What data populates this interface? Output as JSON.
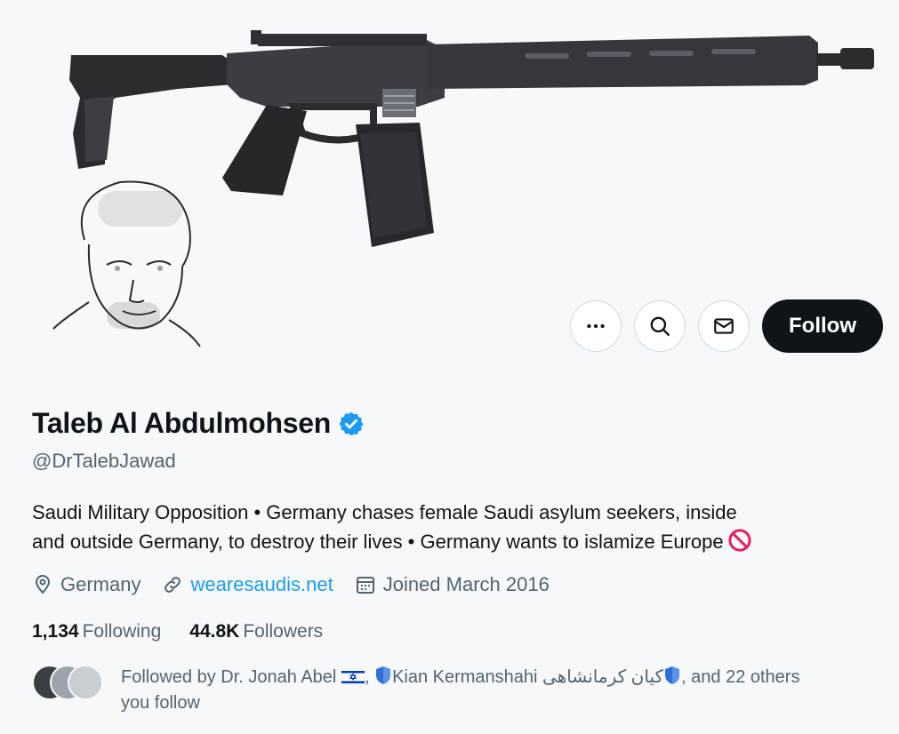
{
  "profile": {
    "display_name": "Taleb Al Abdulmohsen",
    "handle": "@DrTalebJawad",
    "verified": true,
    "bio_line1": "Saudi Military Opposition • Germany chases female Saudi asylum seekers, inside",
    "bio_line2": "and outside Germany, to destroy their lives • Germany wants to islamize Europe",
    "bio_icon": "prohibited-icon",
    "location": "Germany",
    "website": "wearesaudis.net",
    "joined": "Joined March 2016"
  },
  "stats": {
    "following_count": "1,134",
    "following_label": "Following",
    "followers_count": "44.8K",
    "followers_label": "Followers"
  },
  "actions": {
    "more_icon": "more-icon",
    "search_icon": "search-icon",
    "message_icon": "envelope-icon",
    "follow_label": "Follow"
  },
  "followed_by": {
    "prefix": "Followed by Dr. Jonah Abel",
    "sep1": ",",
    "second": "Kian Kermanshahi کیان کرمانشاهی",
    "suffix": ", and 22 others",
    "line2": "you follow"
  },
  "colors": {
    "accent": "#1d9bf0",
    "text": "#0f1419",
    "secondary": "#536471",
    "follow_bg": "#0f1419",
    "prohibited": "#e0245e"
  }
}
